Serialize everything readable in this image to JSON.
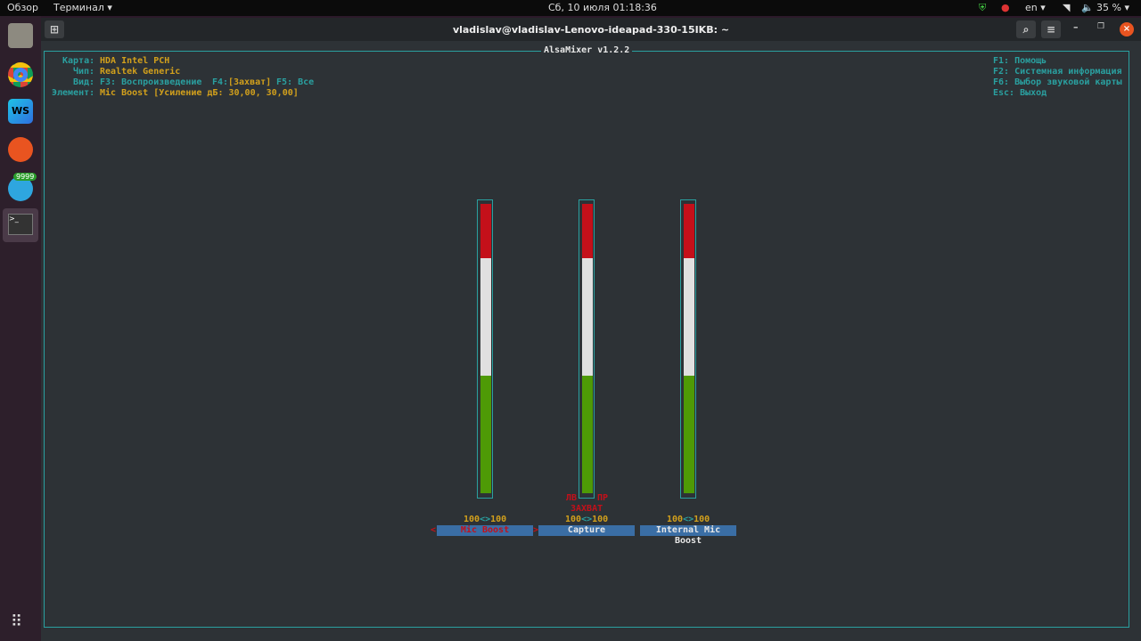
{
  "topbar": {
    "overview": "Обзор",
    "app": "Терминал ▾",
    "clock": "Сб, 10 июля  01:18:36",
    "lang": "en ▾",
    "battery": "35 % ▾"
  },
  "dock": {
    "telegram_badge": "9999"
  },
  "window": {
    "title": "vladislav@vladislav-Lenovo-ideapad-330-15IKB: ~"
  },
  "mixer": {
    "title": "AlsaMixer v1.2.2",
    "card_label": "Карта:",
    "card": "HDA Intel PCH",
    "chip_label": "Чип:",
    "chip": "Realtek Generic",
    "view_label": "Вид:",
    "view_f3": "F3: Воспроизведение",
    "view_f4": "F4:",
    "view_f4_active": "[Захват]",
    "view_f5": "F5: Все",
    "item_label": "Элемент:",
    "item": "Mic Boost [Усиление дБ: 30,00, 30,00]",
    "help": [
      "F1: Помощь",
      "F2: Системная информация",
      "F6: Выбор звуковой карты",
      "Esc: Выход"
    ],
    "channels": [
      {
        "name": "Mic Boost",
        "left": "100",
        "sep": "<>",
        "right": "100",
        "level": 1.0,
        "selected": true
      },
      {
        "name": "Capture",
        "left": "100",
        "sep": "<>",
        "right": "100",
        "level": 1.0,
        "capture_l": "ЛВ",
        "capture_r": "ПР",
        "capture": "ЗАХВАТ"
      },
      {
        "name": "Internal Mic Boost",
        "left": "100",
        "sep": "<>",
        "right": "100",
        "level": 1.0
      }
    ]
  },
  "colors": {
    "red": "#c4101a",
    "white": "#e0e0e0",
    "green": "#4e9a06",
    "accent": "#2aa0a0"
  }
}
